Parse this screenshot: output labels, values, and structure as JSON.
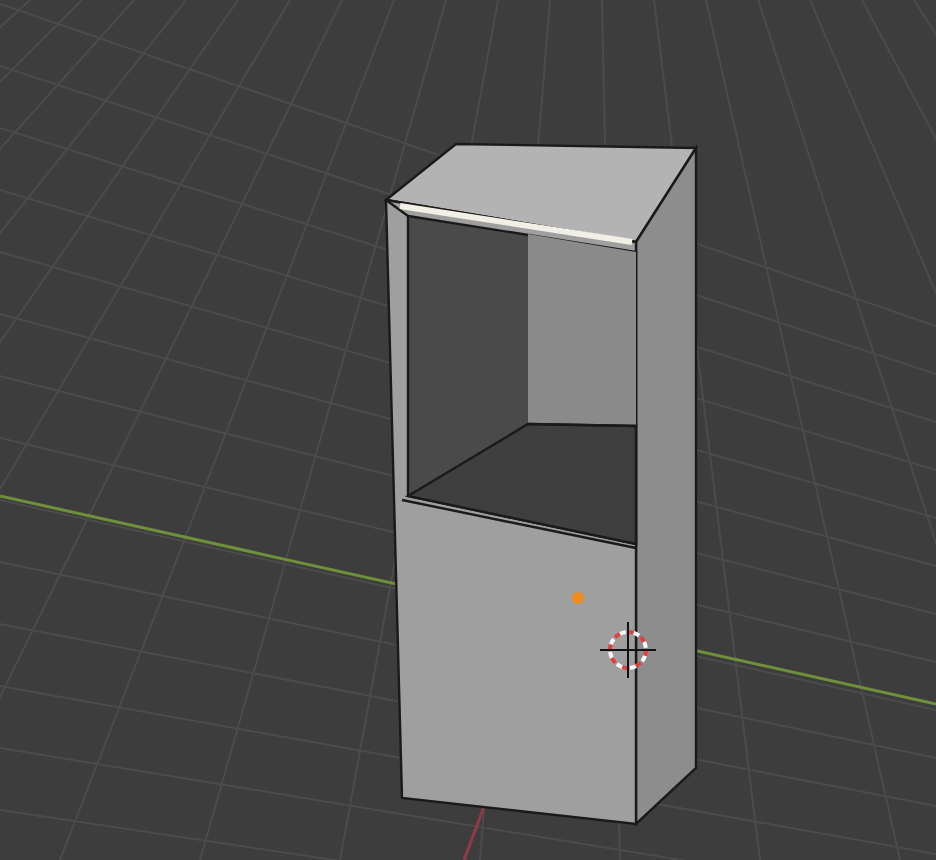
{
  "viewport": {
    "kind": "perspective",
    "edge_selected": true
  }
}
